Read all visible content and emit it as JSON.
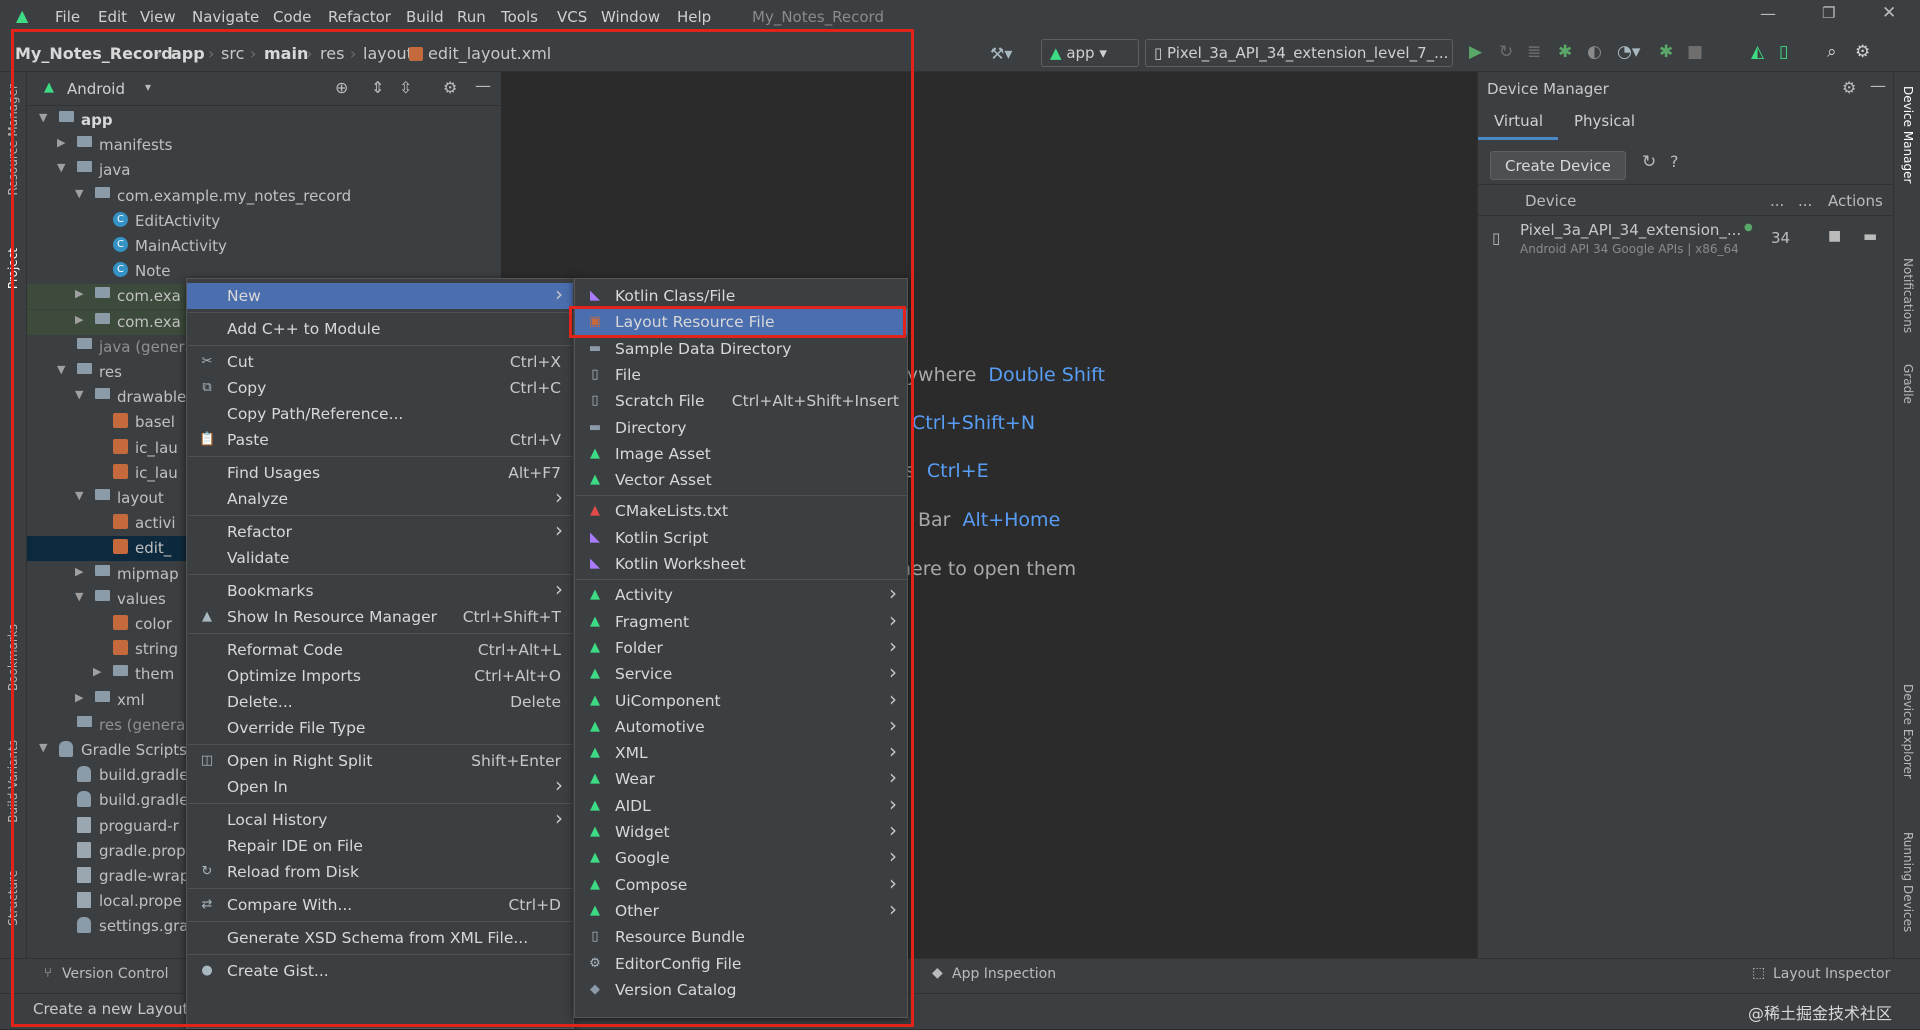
{
  "menubar": {
    "items": [
      "File",
      "Edit",
      "View",
      "Navigate",
      "Code",
      "Refactor",
      "Build",
      "Run",
      "Tools",
      "VCS",
      "Window",
      "Help"
    ],
    "project_title": "My_Notes_Record"
  },
  "breadcrumb": {
    "items": [
      "My_Notes_Record",
      "app",
      "src",
      "main",
      "res",
      "layout",
      "edit_layout.xml"
    ]
  },
  "toolbar": {
    "run_config": "app",
    "device": "Pixel_3a_API_34_extension_level_7_..."
  },
  "project_panel": {
    "view": "Android",
    "tree": [
      {
        "label": "app",
        "level": 0,
        "arrow": "down",
        "icon": "folder",
        "bold": true
      },
      {
        "label": "manifests",
        "level": 1,
        "arrow": "right",
        "icon": "folder"
      },
      {
        "label": "java",
        "level": 1,
        "arrow": "down",
        "icon": "folder"
      },
      {
        "label": "com.example.my_notes_record",
        "level": 2,
        "arrow": "down",
        "icon": "package"
      },
      {
        "label": "EditActivity",
        "level": 3,
        "icon": "class"
      },
      {
        "label": "MainActivity",
        "level": 3,
        "icon": "class"
      },
      {
        "label": "Note",
        "level": 3,
        "icon": "class"
      },
      {
        "label": "com.exa",
        "level": 2,
        "arrow": "right",
        "icon": "package",
        "tint": "green"
      },
      {
        "label": "com.exa",
        "level": 2,
        "arrow": "right",
        "icon": "package",
        "tint": "green"
      },
      {
        "label": "java (genera",
        "level": 1,
        "icon": "folder"
      },
      {
        "label": "res",
        "level": 1,
        "arrow": "down",
        "icon": "folder"
      },
      {
        "label": "drawable",
        "level": 2,
        "arrow": "down",
        "icon": "folder"
      },
      {
        "label": "basel",
        "level": 3,
        "icon": "xml"
      },
      {
        "label": "ic_lau",
        "level": 3,
        "icon": "xml"
      },
      {
        "label": "ic_lau",
        "level": 3,
        "icon": "xml"
      },
      {
        "label": "layout",
        "level": 2,
        "arrow": "down",
        "icon": "folder"
      },
      {
        "label": "activi",
        "level": 3,
        "icon": "xml"
      },
      {
        "label": "edit_",
        "level": 3,
        "icon": "xml",
        "selected": true
      },
      {
        "label": "mipmap",
        "level": 2,
        "arrow": "right",
        "icon": "folder"
      },
      {
        "label": "values",
        "level": 2,
        "arrow": "down",
        "icon": "folder"
      },
      {
        "label": "color",
        "level": 3,
        "icon": "xml"
      },
      {
        "label": "string",
        "level": 3,
        "icon": "xml"
      },
      {
        "label": "them",
        "level": 3,
        "arrow": "right",
        "icon": "folder"
      },
      {
        "label": "xml",
        "level": 2,
        "arrow": "right",
        "icon": "folder"
      },
      {
        "label": "res (genera",
        "level": 1,
        "icon": "folder"
      },
      {
        "label": "Gradle Scripts",
        "level": 0,
        "arrow": "down",
        "icon": "gradle"
      },
      {
        "label": "build.gradle",
        "level": 1,
        "icon": "gradle"
      },
      {
        "label": "build.gradle",
        "level": 1,
        "icon": "gradle"
      },
      {
        "label": "proguard-r",
        "level": 1,
        "icon": "file"
      },
      {
        "label": "gradle.prop",
        "level": 1,
        "icon": "file"
      },
      {
        "label": "gradle-wrap",
        "level": 1,
        "icon": "file"
      },
      {
        "label": "local.prope",
        "level": 1,
        "icon": "file"
      },
      {
        "label": "settings.gra",
        "level": 1,
        "icon": "gradle"
      }
    ]
  },
  "left_strip": [
    "Resource Manager",
    "Project",
    "Bookmarks",
    "Build Variants",
    "Structure"
  ],
  "right_strip": [
    "Device Manager",
    "Notifications",
    "Gradle",
    "Device Explorer",
    "Running Devices"
  ],
  "editor_hints": [
    {
      "text": "rywhere",
      "key": "Double Shift"
    },
    {
      "text": "",
      "key": "Ctrl+Shift+N"
    },
    {
      "text": "s",
      "key": "Ctrl+E"
    },
    {
      "text": "Bar",
      "key": "Alt+Home"
    },
    {
      "text": "here to open them",
      "key": ""
    }
  ],
  "device_manager": {
    "title": "Device Manager",
    "tabs": [
      "Virtual",
      "Physical"
    ],
    "create_button": "Create Device",
    "columns": {
      "device": "Device",
      "dots1": "...",
      "dots2": "...",
      "actions": "Actions"
    },
    "device_name": "Pixel_3a_API_34_extension_...",
    "device_sub": "Android API 34 Google APIs | x86_64",
    "api": "34"
  },
  "bottom": {
    "version_control": "Version Control",
    "app_inspection": "App Inspection",
    "layout_inspector": "Layout Inspector",
    "status": "Create a new Layout"
  },
  "context_menu": [
    {
      "label": "New",
      "sub": true,
      "sel": true
    },
    {
      "sep": true
    },
    {
      "label": "Add C++ to Module"
    },
    {
      "sep": true
    },
    {
      "label": "Cut",
      "sc": "Ctrl+X",
      "icon": "✂"
    },
    {
      "label": "Copy",
      "sc": "Ctrl+C",
      "icon": "⧉"
    },
    {
      "label": "Copy Path/Reference..."
    },
    {
      "label": "Paste",
      "sc": "Ctrl+V",
      "icon": "📋"
    },
    {
      "sep": true
    },
    {
      "label": "Find Usages",
      "sc": "Alt+F7"
    },
    {
      "label": "Analyze",
      "sub": true
    },
    {
      "sep": true
    },
    {
      "label": "Refactor",
      "sub": true
    },
    {
      "label": "Validate"
    },
    {
      "sep": true
    },
    {
      "label": "Bookmarks",
      "sub": true
    },
    {
      "label": "Show In Resource Manager",
      "sc": "Ctrl+Shift+T",
      "icon": "▲"
    },
    {
      "sep": true
    },
    {
      "label": "Reformat Code",
      "sc": "Ctrl+Alt+L"
    },
    {
      "label": "Optimize Imports",
      "sc": "Ctrl+Alt+O"
    },
    {
      "label": "Delete...",
      "sc": "Delete"
    },
    {
      "label": "Override File Type"
    },
    {
      "sep": true
    },
    {
      "label": "Open in Right Split",
      "sc": "Shift+Enter",
      "icon": "◫"
    },
    {
      "label": "Open In",
      "sub": true
    },
    {
      "sep": true
    },
    {
      "label": "Local History",
      "sub": true
    },
    {
      "label": "Repair IDE on File"
    },
    {
      "label": "Reload from Disk",
      "icon": "↻"
    },
    {
      "sep": true
    },
    {
      "label": "Compare With...",
      "sc": "Ctrl+D",
      "icon": "⇄"
    },
    {
      "sep": true
    },
    {
      "label": "Generate XSD Schema from XML File..."
    },
    {
      "sep": true
    },
    {
      "label": "Create Gist...",
      "icon": "●"
    }
  ],
  "submenu": [
    {
      "label": "Kotlin Class/File",
      "icon": "kotlin"
    },
    {
      "label": "Layout Resource File",
      "icon": "layout",
      "sel": true
    },
    {
      "label": "Sample Data Directory",
      "icon": "folder"
    },
    {
      "label": "File",
      "icon": "file"
    },
    {
      "label": "Scratch File",
      "sc": "Ctrl+Alt+Shift+Insert",
      "icon": "file"
    },
    {
      "label": "Directory",
      "icon": "folder"
    },
    {
      "label": "Image Asset",
      "icon": "droid"
    },
    {
      "label": "Vector Asset",
      "icon": "droid"
    },
    {
      "sep": true
    },
    {
      "label": "CMakeLists.txt",
      "icon": "cmake"
    },
    {
      "label": "Kotlin Script",
      "icon": "kotlin"
    },
    {
      "label": "Kotlin Worksheet",
      "icon": "kotlin"
    },
    {
      "sep": true
    },
    {
      "label": "Activity",
      "sub": true,
      "icon": "droid"
    },
    {
      "label": "Fragment",
      "sub": true,
      "icon": "droid"
    },
    {
      "label": "Folder",
      "sub": true,
      "icon": "droid"
    },
    {
      "label": "Service",
      "sub": true,
      "icon": "droid"
    },
    {
      "label": "UiComponent",
      "sub": true,
      "icon": "droid"
    },
    {
      "label": "Automotive",
      "sub": true,
      "icon": "droid"
    },
    {
      "label": "XML",
      "sub": true,
      "icon": "droid"
    },
    {
      "label": "Wear",
      "sub": true,
      "icon": "droid"
    },
    {
      "label": "AIDL",
      "sub": true,
      "icon": "droid"
    },
    {
      "label": "Widget",
      "sub": true,
      "icon": "droid"
    },
    {
      "label": "Google",
      "sub": true,
      "icon": "droid"
    },
    {
      "label": "Compose",
      "sub": true,
      "icon": "droid"
    },
    {
      "label": "Other",
      "sub": true,
      "icon": "droid"
    },
    {
      "label": "Resource Bundle",
      "icon": "file"
    },
    {
      "label": "EditorConfig File",
      "icon": "gear"
    },
    {
      "label": "Version Catalog",
      "icon": "gradle"
    }
  ],
  "watermark": "@稀土掘金技术社区",
  "colors": {
    "accent": "#4b6eaf",
    "highlight": "#e2231a",
    "android": "#3ddc84",
    "link": "#589df6"
  }
}
